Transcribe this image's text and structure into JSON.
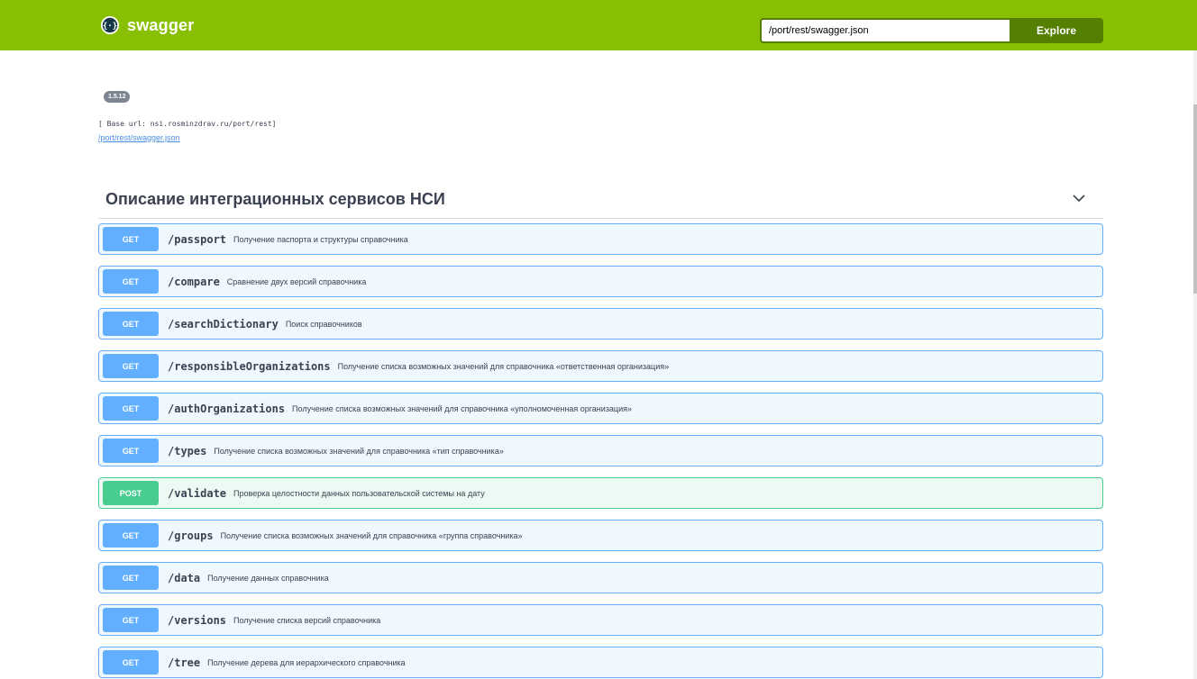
{
  "topbar": {
    "logo_text": "swagger",
    "url_value": "/port/rest/swagger.json",
    "explore_label": "Explore",
    "colors": {
      "bar": "#89bf04",
      "button": "#547f00"
    }
  },
  "info": {
    "version": "1.5.12",
    "base_url": "[ Base url: nsi.rosminzdrav.ru/port/rest]",
    "spec_link": "/port/rest/swagger.json"
  },
  "tag": {
    "title": "Описание интеграционных сервисов НСИ",
    "icon": "chevron-down-icon"
  },
  "operations": [
    {
      "method": "GET",
      "path": "/passport",
      "summary": "Получение паспорта и структуры справочника"
    },
    {
      "method": "GET",
      "path": "/compare",
      "summary": "Сравнение двух версий справочника"
    },
    {
      "method": "GET",
      "path": "/searchDictionary",
      "summary": "Поиск справочников"
    },
    {
      "method": "GET",
      "path": "/responsibleOrganizations",
      "summary": "Получение списка возможных значений для справочника «ответственная организация»"
    },
    {
      "method": "GET",
      "path": "/authOrganizations",
      "summary": "Получение списка возможных значений для справочника «уполномоченная организация»"
    },
    {
      "method": "GET",
      "path": "/types",
      "summary": "Получение списка возможных значений для справочника «тип справочника»"
    },
    {
      "method": "POST",
      "path": "/validate",
      "summary": "Проверка целостности данных пользовательской системы на дату"
    },
    {
      "method": "GET",
      "path": "/groups",
      "summary": "Получение списка возможных значений для справочника «группа справочника»"
    },
    {
      "method": "GET",
      "path": "/data",
      "summary": "Получение данных справочника"
    },
    {
      "method": "GET",
      "path": "/versions",
      "summary": "Получение списка версий справочника"
    },
    {
      "method": "GET",
      "path": "/tree",
      "summary": "Получение дерева для иерархического справочника"
    }
  ],
  "method_colors": {
    "GET": "#61affe",
    "POST": "#49cc90"
  }
}
